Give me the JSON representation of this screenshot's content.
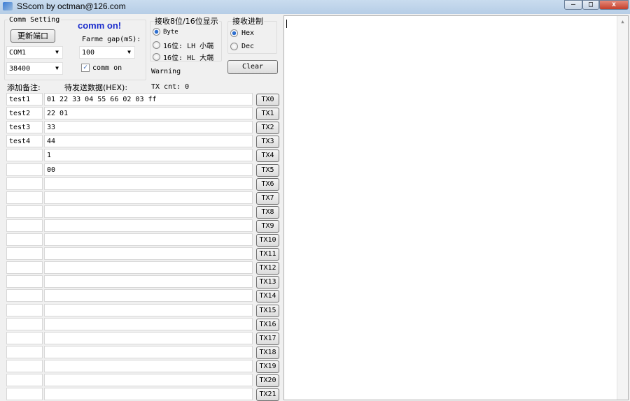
{
  "window": {
    "title": "SScom by octman@126.com",
    "minimize": "–",
    "maximize": "□",
    "close": "x"
  },
  "comm_setting": {
    "title": "Comm Setting",
    "refresh_port": "更新端口",
    "port": "COM1",
    "baud": "38400",
    "status": "comm on!",
    "frame_gap_label": "Farme gap(mS):",
    "frame_gap": "100",
    "comm_on_label": "comm on",
    "comm_on_checked": true
  },
  "display_mode": {
    "title": "接收8位/16位显示",
    "options": [
      "Byte",
      "16位: LH 小端",
      "16位: HL 大端"
    ],
    "selected": 0
  },
  "radix": {
    "title": "接收进制",
    "options": [
      "Hex",
      "Dec"
    ],
    "selected": 0
  },
  "clear": "Clear",
  "warning": "Warning",
  "tx_cnt": "TX cnt:  0",
  "headers": {
    "note": "添加备注:",
    "data": "待发送数据(HEX):"
  },
  "rows": [
    {
      "note": "test1",
      "data": "01 22 33 04 55 66 02 03 ff",
      "btn": "TX0"
    },
    {
      "note": "test2",
      "data": "22 01",
      "btn": "TX1"
    },
    {
      "note": "test3",
      "data": "33",
      "btn": "TX2"
    },
    {
      "note": "test4",
      "data": "44",
      "btn": "TX3"
    },
    {
      "note": "",
      "data": "1",
      "btn": "TX4"
    },
    {
      "note": "",
      "data": "00",
      "btn": "TX5"
    },
    {
      "note": "",
      "data": "",
      "btn": "TX6"
    },
    {
      "note": "",
      "data": "",
      "btn": "TX7"
    },
    {
      "note": "",
      "data": "",
      "btn": "TX8"
    },
    {
      "note": "",
      "data": "",
      "btn": "TX9"
    },
    {
      "note": "",
      "data": "",
      "btn": "TX10"
    },
    {
      "note": "",
      "data": "",
      "btn": "TX11"
    },
    {
      "note": "",
      "data": "",
      "btn": "TX12"
    },
    {
      "note": "",
      "data": "",
      "btn": "TX13"
    },
    {
      "note": "",
      "data": "",
      "btn": "TX14"
    },
    {
      "note": "",
      "data": "",
      "btn": "TX15"
    },
    {
      "note": "",
      "data": "",
      "btn": "TX16"
    },
    {
      "note": "",
      "data": "",
      "btn": "TX17"
    },
    {
      "note": "",
      "data": "",
      "btn": "TX18"
    },
    {
      "note": "",
      "data": "",
      "btn": "TX19"
    },
    {
      "note": "",
      "data": "",
      "btn": "TX20"
    },
    {
      "note": "",
      "data": "",
      "btn": "TX21"
    }
  ],
  "receive": {
    "text": ""
  }
}
